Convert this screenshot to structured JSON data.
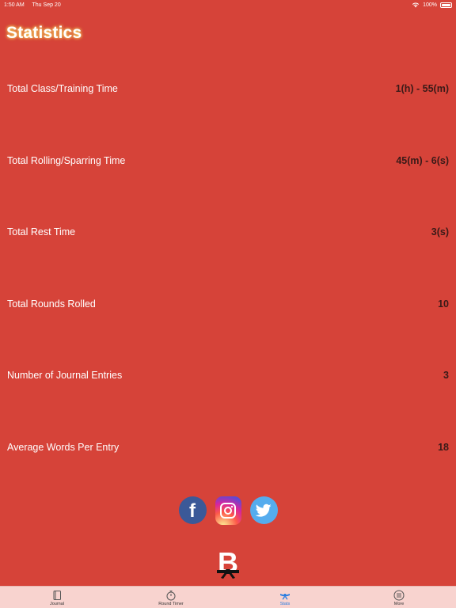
{
  "status": {
    "time": "1:50 AM",
    "date": "Thu Sep 20",
    "battery": "100%"
  },
  "page": {
    "title": "Statistics"
  },
  "stats": [
    {
      "label": "Total Class/Training Time",
      "value": "1(h) - 55(m)"
    },
    {
      "label": "Total Rolling/Sparring Time",
      "value": "45(m) - 6(s)"
    },
    {
      "label": "Total Rest Time",
      "value": "3(s)"
    },
    {
      "label": "Total Rounds Rolled",
      "value": "10"
    },
    {
      "label": "Number of Journal Entries",
      "value": "3"
    },
    {
      "label": "Average Words Per Entry",
      "value": "18"
    }
  ],
  "social": {
    "facebook_letter": "f"
  },
  "logo": {
    "letter": "B"
  },
  "tabs": [
    {
      "label": "Journal",
      "icon": "notebook-icon"
    },
    {
      "label": "Round Timer",
      "icon": "stopwatch-icon"
    },
    {
      "label": "Stats",
      "icon": "belt-icon"
    },
    {
      "label": "More",
      "icon": "menu-circle-icon"
    }
  ],
  "colors": {
    "background": "#d64339",
    "tabbar": "#f8d3cf",
    "active_tab": "#2a7de1",
    "value_text": "#3a1a18"
  }
}
